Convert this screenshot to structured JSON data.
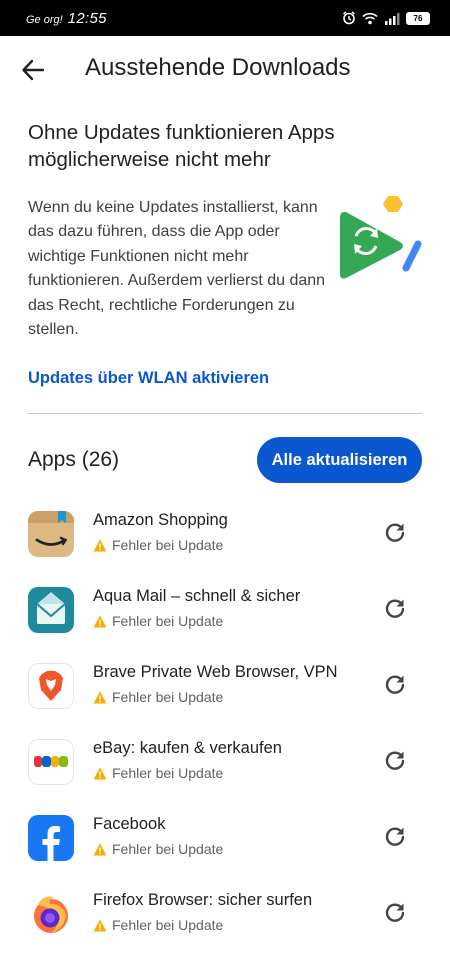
{
  "status_bar": {
    "carrier": "Ge org!",
    "time": "12:55",
    "battery": "76"
  },
  "app_bar": {
    "title": "Ausstehende Downloads"
  },
  "info": {
    "heading": "Ohne Updates funktionieren Apps möglicherweise nicht mehr",
    "body": "Wenn du keine Updates installierst, kann das dazu führen, dass die App oder wichtige Funktionen nicht mehr funktionieren. Außerdem verlierst du dann das Recht, rechtliche Forderungen zu stellen.",
    "link": "Updates über WLAN aktivieren"
  },
  "apps_section": {
    "title": "Apps (26)",
    "update_all": "Alle aktualisieren"
  },
  "apps": [
    {
      "name": "Amazon Shopping",
      "status": "Fehler bei Update",
      "icon": "amazon-icon"
    },
    {
      "name": "Aqua Mail – schnell & sicher",
      "status": "Fehler bei Update",
      "icon": "aqua-mail-icon"
    },
    {
      "name": "Brave Private Web Browser, VPN",
      "status": "Fehler bei Update",
      "icon": "brave-icon"
    },
    {
      "name": "eBay: kaufen & verkaufen",
      "status": "Fehler bei Update",
      "icon": "ebay-icon"
    },
    {
      "name": "Facebook",
      "status": "Fehler bei Update",
      "icon": "facebook-icon"
    },
    {
      "name": "Firefox Browser: sicher surfen",
      "status": "Fehler bei Update",
      "icon": "firefox-icon"
    }
  ],
  "colors": {
    "accent": "#0b57d0",
    "warning": "#f9ab00",
    "text": "#202124"
  }
}
